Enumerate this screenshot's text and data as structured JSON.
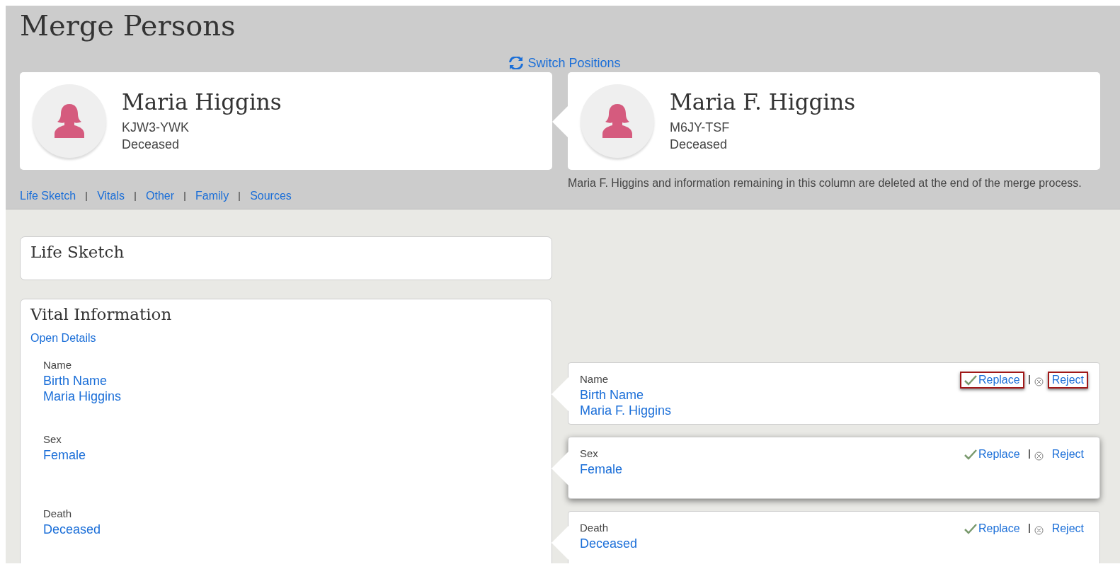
{
  "title": "Merge Persons",
  "switch_link": "Switch Positions",
  "persons": [
    {
      "name": "Maria Higgins",
      "id": "KJW3-YWK",
      "status": "Deceased"
    },
    {
      "name": "Maria F. Higgins",
      "id": "M6JY-TSF",
      "status": "Deceased"
    }
  ],
  "section_links": [
    "Life Sketch",
    "Vitals",
    "Other",
    "Family",
    "Sources"
  ],
  "notice": "Maria F. Higgins and information remaining in this column are deleted at the end of the merge process.",
  "life_sketch": {
    "title": "Life Sketch"
  },
  "vital_information": {
    "title": "Vital Information",
    "open_details": "Open Details",
    "rows": [
      {
        "label": "Name",
        "left_values": [
          "Birth Name",
          "Maria Higgins"
        ],
        "right_label": "Name",
        "right_values": [
          "Birth Name",
          "Maria F. Higgins"
        ],
        "replace": "Replace",
        "reject": "Reject",
        "highlighted": true,
        "raised": false
      },
      {
        "label": "Sex",
        "left_values": [
          "Female"
        ],
        "right_label": "Sex",
        "right_values": [
          "Female"
        ],
        "replace": "Replace",
        "reject": "Reject",
        "highlighted": false,
        "raised": true
      },
      {
        "label": "Death",
        "left_values": [
          "Deceased"
        ],
        "right_label": "Death",
        "right_values": [
          "Deceased"
        ],
        "replace": "Replace",
        "reject": "Reject",
        "highlighted": false,
        "raised": false
      }
    ]
  }
}
